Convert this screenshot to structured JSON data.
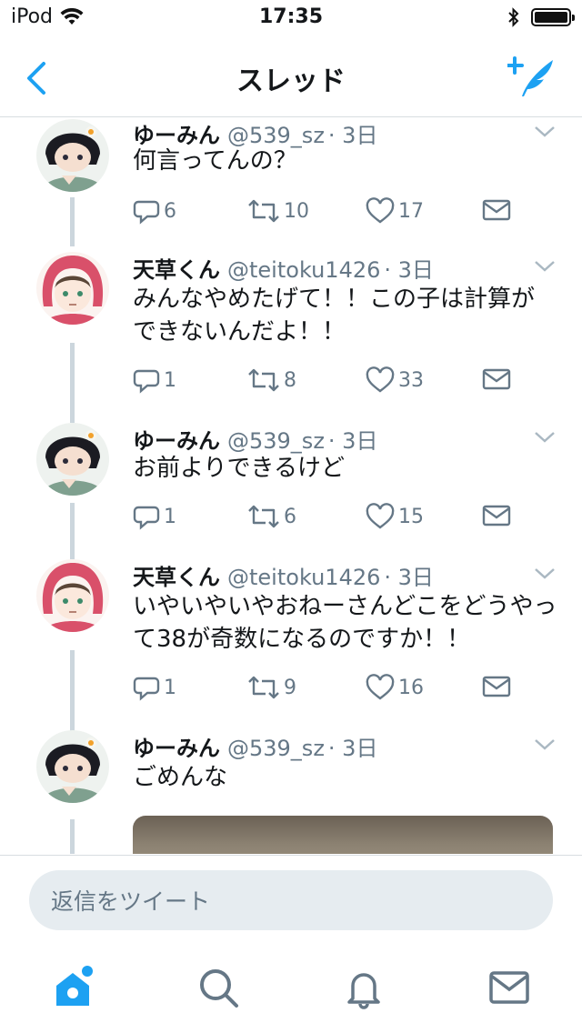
{
  "status_bar": {
    "carrier": "iPod",
    "time": "17:35"
  },
  "nav": {
    "title": "スレッド",
    "back_icon": "chevron-left-icon",
    "compose_icon": "compose-tweet-icon"
  },
  "colors": {
    "accent": "#1da1f2",
    "muted": "#657786",
    "thread_line": "#ccd6dd",
    "border": "#d8dde1",
    "input_bg": "#e6ecf0"
  },
  "tweets": [
    {
      "name": "ゆーみん",
      "handle": "@539_sz",
      "time": "· 3日",
      "text": "何言ってんの？",
      "replies": "6",
      "retweets": "10",
      "likes": "17"
    },
    {
      "name": "天草くん",
      "handle": "@teitoku1426",
      "time": "· 3日",
      "text": "みんなやめたげて！！この子は計算ができないんだよ！！",
      "replies": "1",
      "retweets": "8",
      "likes": "33"
    },
    {
      "name": "ゆーみん",
      "handle": "@539_sz",
      "time": "· 3日",
      "text": "お前よりできるけど",
      "replies": "1",
      "retweets": "6",
      "likes": "15"
    },
    {
      "name": "天草くん",
      "handle": "@teitoku1426",
      "time": "· 3日",
      "text": "いやいやいやおねーさんどこをどうやって38が奇数になるのですか！！",
      "replies": "1",
      "retweets": "9",
      "likes": "16"
    },
    {
      "name": "ゆーみん",
      "handle": "@539_sz",
      "time": "· 3日",
      "text": "ごめんな"
    }
  ],
  "reply": {
    "placeholder": "返信をツイート"
  },
  "tabs": [
    {
      "name": "home",
      "icon": "home-icon"
    },
    {
      "name": "search",
      "icon": "search-icon"
    },
    {
      "name": "notifications",
      "icon": "bell-icon"
    },
    {
      "name": "messages",
      "icon": "mail-icon"
    }
  ]
}
